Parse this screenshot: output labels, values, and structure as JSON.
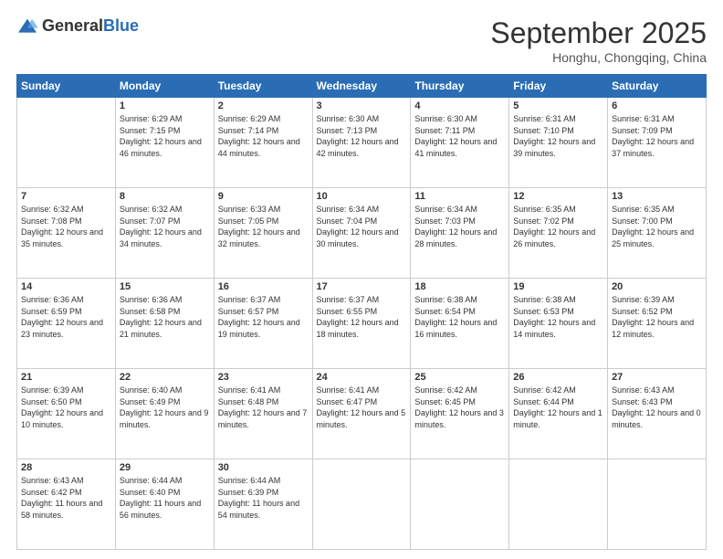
{
  "header": {
    "logo_general": "General",
    "logo_blue": "Blue",
    "month": "September 2025",
    "location": "Honghu, Chongqing, China"
  },
  "weekdays": [
    "Sunday",
    "Monday",
    "Tuesday",
    "Wednesday",
    "Thursday",
    "Friday",
    "Saturday"
  ],
  "weeks": [
    [
      {
        "day": "",
        "sunrise": "",
        "sunset": "",
        "daylight": ""
      },
      {
        "day": "1",
        "sunrise": "Sunrise: 6:29 AM",
        "sunset": "Sunset: 7:15 PM",
        "daylight": "Daylight: 12 hours and 46 minutes."
      },
      {
        "day": "2",
        "sunrise": "Sunrise: 6:29 AM",
        "sunset": "Sunset: 7:14 PM",
        "daylight": "Daylight: 12 hours and 44 minutes."
      },
      {
        "day": "3",
        "sunrise": "Sunrise: 6:30 AM",
        "sunset": "Sunset: 7:13 PM",
        "daylight": "Daylight: 12 hours and 42 minutes."
      },
      {
        "day": "4",
        "sunrise": "Sunrise: 6:30 AM",
        "sunset": "Sunset: 7:11 PM",
        "daylight": "Daylight: 12 hours and 41 minutes."
      },
      {
        "day": "5",
        "sunrise": "Sunrise: 6:31 AM",
        "sunset": "Sunset: 7:10 PM",
        "daylight": "Daylight: 12 hours and 39 minutes."
      },
      {
        "day": "6",
        "sunrise": "Sunrise: 6:31 AM",
        "sunset": "Sunset: 7:09 PM",
        "daylight": "Daylight: 12 hours and 37 minutes."
      }
    ],
    [
      {
        "day": "7",
        "sunrise": "Sunrise: 6:32 AM",
        "sunset": "Sunset: 7:08 PM",
        "daylight": "Daylight: 12 hours and 35 minutes."
      },
      {
        "day": "8",
        "sunrise": "Sunrise: 6:32 AM",
        "sunset": "Sunset: 7:07 PM",
        "daylight": "Daylight: 12 hours and 34 minutes."
      },
      {
        "day": "9",
        "sunrise": "Sunrise: 6:33 AM",
        "sunset": "Sunset: 7:05 PM",
        "daylight": "Daylight: 12 hours and 32 minutes."
      },
      {
        "day": "10",
        "sunrise": "Sunrise: 6:34 AM",
        "sunset": "Sunset: 7:04 PM",
        "daylight": "Daylight: 12 hours and 30 minutes."
      },
      {
        "day": "11",
        "sunrise": "Sunrise: 6:34 AM",
        "sunset": "Sunset: 7:03 PM",
        "daylight": "Daylight: 12 hours and 28 minutes."
      },
      {
        "day": "12",
        "sunrise": "Sunrise: 6:35 AM",
        "sunset": "Sunset: 7:02 PM",
        "daylight": "Daylight: 12 hours and 26 minutes."
      },
      {
        "day": "13",
        "sunrise": "Sunrise: 6:35 AM",
        "sunset": "Sunset: 7:00 PM",
        "daylight": "Daylight: 12 hours and 25 minutes."
      }
    ],
    [
      {
        "day": "14",
        "sunrise": "Sunrise: 6:36 AM",
        "sunset": "Sunset: 6:59 PM",
        "daylight": "Daylight: 12 hours and 23 minutes."
      },
      {
        "day": "15",
        "sunrise": "Sunrise: 6:36 AM",
        "sunset": "Sunset: 6:58 PM",
        "daylight": "Daylight: 12 hours and 21 minutes."
      },
      {
        "day": "16",
        "sunrise": "Sunrise: 6:37 AM",
        "sunset": "Sunset: 6:57 PM",
        "daylight": "Daylight: 12 hours and 19 minutes."
      },
      {
        "day": "17",
        "sunrise": "Sunrise: 6:37 AM",
        "sunset": "Sunset: 6:55 PM",
        "daylight": "Daylight: 12 hours and 18 minutes."
      },
      {
        "day": "18",
        "sunrise": "Sunrise: 6:38 AM",
        "sunset": "Sunset: 6:54 PM",
        "daylight": "Daylight: 12 hours and 16 minutes."
      },
      {
        "day": "19",
        "sunrise": "Sunrise: 6:38 AM",
        "sunset": "Sunset: 6:53 PM",
        "daylight": "Daylight: 12 hours and 14 minutes."
      },
      {
        "day": "20",
        "sunrise": "Sunrise: 6:39 AM",
        "sunset": "Sunset: 6:52 PM",
        "daylight": "Daylight: 12 hours and 12 minutes."
      }
    ],
    [
      {
        "day": "21",
        "sunrise": "Sunrise: 6:39 AM",
        "sunset": "Sunset: 6:50 PM",
        "daylight": "Daylight: 12 hours and 10 minutes."
      },
      {
        "day": "22",
        "sunrise": "Sunrise: 6:40 AM",
        "sunset": "Sunset: 6:49 PM",
        "daylight": "Daylight: 12 hours and 9 minutes."
      },
      {
        "day": "23",
        "sunrise": "Sunrise: 6:41 AM",
        "sunset": "Sunset: 6:48 PM",
        "daylight": "Daylight: 12 hours and 7 minutes."
      },
      {
        "day": "24",
        "sunrise": "Sunrise: 6:41 AM",
        "sunset": "Sunset: 6:47 PM",
        "daylight": "Daylight: 12 hours and 5 minutes."
      },
      {
        "day": "25",
        "sunrise": "Sunrise: 6:42 AM",
        "sunset": "Sunset: 6:45 PM",
        "daylight": "Daylight: 12 hours and 3 minutes."
      },
      {
        "day": "26",
        "sunrise": "Sunrise: 6:42 AM",
        "sunset": "Sunset: 6:44 PM",
        "daylight": "Daylight: 12 hours and 1 minute."
      },
      {
        "day": "27",
        "sunrise": "Sunrise: 6:43 AM",
        "sunset": "Sunset: 6:43 PM",
        "daylight": "Daylight: 12 hours and 0 minutes."
      }
    ],
    [
      {
        "day": "28",
        "sunrise": "Sunrise: 6:43 AM",
        "sunset": "Sunset: 6:42 PM",
        "daylight": "Daylight: 11 hours and 58 minutes."
      },
      {
        "day": "29",
        "sunrise": "Sunrise: 6:44 AM",
        "sunset": "Sunset: 6:40 PM",
        "daylight": "Daylight: 11 hours and 56 minutes."
      },
      {
        "day": "30",
        "sunrise": "Sunrise: 6:44 AM",
        "sunset": "Sunset: 6:39 PM",
        "daylight": "Daylight: 11 hours and 54 minutes."
      },
      {
        "day": "",
        "sunrise": "",
        "sunset": "",
        "daylight": ""
      },
      {
        "day": "",
        "sunrise": "",
        "sunset": "",
        "daylight": ""
      },
      {
        "day": "",
        "sunrise": "",
        "sunset": "",
        "daylight": ""
      },
      {
        "day": "",
        "sunrise": "",
        "sunset": "",
        "daylight": ""
      }
    ]
  ]
}
